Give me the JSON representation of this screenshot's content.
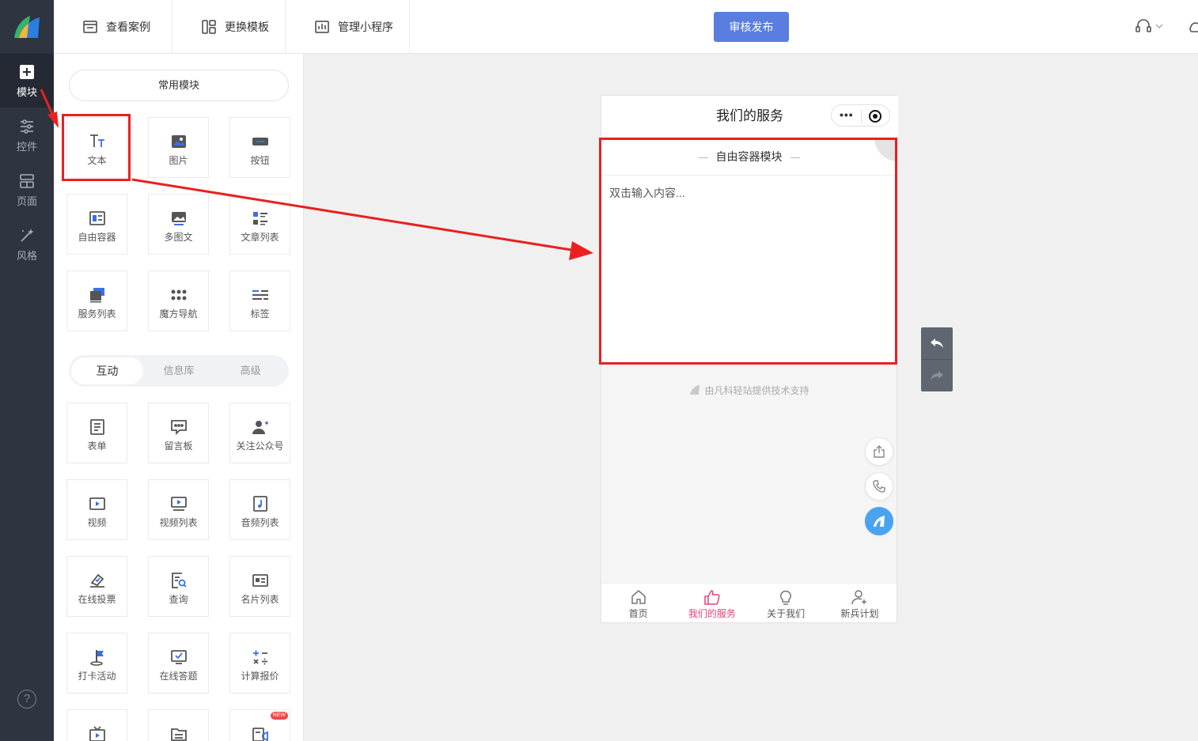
{
  "rail": {
    "items": [
      {
        "label": "模块",
        "icon": "plus-square-icon"
      },
      {
        "label": "控件",
        "icon": "sliders-icon"
      },
      {
        "label": "页面",
        "icon": "pages-icon"
      },
      {
        "label": "风格",
        "icon": "magic-wand-icon"
      }
    ],
    "help": "?"
  },
  "topbar": {
    "cases": "查看案例",
    "template": "更换模板",
    "manage": "管理小程序",
    "publish": "审核发布"
  },
  "panel": {
    "common_label": "常用模块",
    "common_items": [
      "文本",
      "图片",
      "按钮",
      "自由容器",
      "多图文",
      "文章列表",
      "服务列表",
      "魔方导航",
      "标签"
    ],
    "tabs": [
      "互动",
      "信息库",
      "高级"
    ],
    "interactive_items": [
      "表单",
      "留言板",
      "关注公众号",
      "视频",
      "视频列表",
      "音频列表",
      "在线投票",
      "查询",
      "名片列表",
      "打卡活动",
      "在线答题",
      "计算报价"
    ],
    "new_badge": "NEW"
  },
  "phone": {
    "title": "我们的服务",
    "module_title": "自由容器模块",
    "placeholder": "双击输入内容...",
    "support": "由凡科轻站提供技术支持",
    "tabs": [
      "首页",
      "我们的服务",
      "关于我们",
      "新兵计划"
    ]
  },
  "colors": {
    "primary": "#5a7ee0",
    "accent_pink": "#e8417a",
    "annotation_red": "#ea2020",
    "rail_bg": "#2e3440"
  }
}
